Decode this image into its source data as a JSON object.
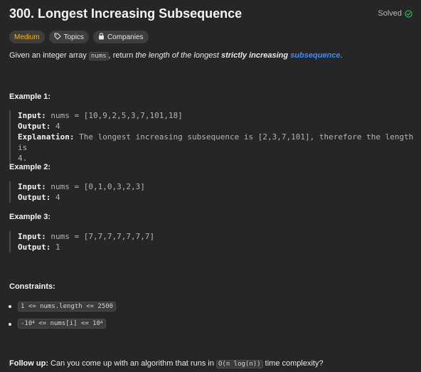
{
  "header": {
    "title": "300. Longest Increasing Subsequence",
    "status": "Solved"
  },
  "tags": {
    "difficulty": "Medium",
    "topics": "Topics",
    "companies": "Companies"
  },
  "description": {
    "part1": "Given an integer array ",
    "code": "nums",
    "part2": ", return ",
    "italic": "the length of the longest ",
    "bold": "strictly increasing ",
    "link": "subsequence",
    "end": "."
  },
  "examples": [
    {
      "title": "Example 1:",
      "input_label": "Input:",
      "input": " nums = [10,9,2,5,3,7,101,18]",
      "output_label": "Output:",
      "output": " 4",
      "explanation_label": "Explanation:",
      "explanation_line1": " The longest increasing subsequence is [2,3,7,101], therefore the length is",
      "explanation_line2": "4."
    },
    {
      "title": "Example 2:",
      "input_label": "Input:",
      "input": " nums = [0,1,0,3,2,3]",
      "output_label": "Output:",
      "output": " 4"
    },
    {
      "title": "Example 3:",
      "input_label": "Input:",
      "input": " nums = [7,7,7,7,7,7,7]",
      "output_label": "Output:",
      "output": " 1"
    }
  ],
  "constraints": {
    "title": "Constraints:",
    "c1": "1 <= nums.length <= 2500",
    "c2_a": "-10",
    "c2_exp": "4",
    "c2_b": " <= nums[i] <= 10",
    "c2_exp2": "4"
  },
  "followup": {
    "label": "Follow up:",
    "text1": " Can you come up with an algorithm that runs in ",
    "code": "O(n log(n))",
    "text2": " time complexity?"
  }
}
